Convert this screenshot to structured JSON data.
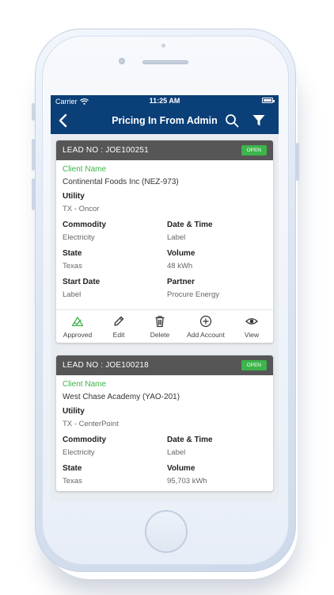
{
  "statusbar": {
    "carrier": "Carrier",
    "time": "11:25 AM"
  },
  "header": {
    "title": "Pricing In From Admin"
  },
  "labels": {
    "client_name": "Client Name",
    "utility": "Utility",
    "commodity": "Commodity",
    "date_time": "Date & Time",
    "state": "State",
    "volume": "Volume",
    "start_date": "Start Date",
    "partner": "Partner"
  },
  "cards": [
    {
      "lead": "LEAD NO :  JOE100251",
      "status": "OPEN",
      "client": "Continental Foods Inc (NEZ-973)",
      "utility": "TX - Oncor",
      "commodity": "Electricity",
      "date_time": "Label",
      "state": "Texas",
      "volume": "48 kWh",
      "start_date": "Label",
      "partner": "Procure Energy",
      "actions": [
        "Approved",
        "Edit",
        "Delete",
        "Add Account",
        "View"
      ]
    },
    {
      "lead": "LEAD NO :  JOE100218",
      "status": "OPEN",
      "client": "West Chase Academy (YAO-201)",
      "utility": "TX - CenterPoint",
      "commodity": "Electricity",
      "date_time": "Label",
      "state": "Texas",
      "volume": "95,703 kWh"
    }
  ],
  "colors": {
    "navbar": "#0b3f78",
    "accent_green": "#3cb54a",
    "card_header": "#565656"
  },
  "icons": [
    "wifi-icon",
    "battery-icon",
    "back-chevron-icon",
    "search-icon",
    "filter-icon",
    "approved-icon",
    "edit-icon",
    "delete-icon",
    "add-account-icon",
    "view-icon"
  ]
}
